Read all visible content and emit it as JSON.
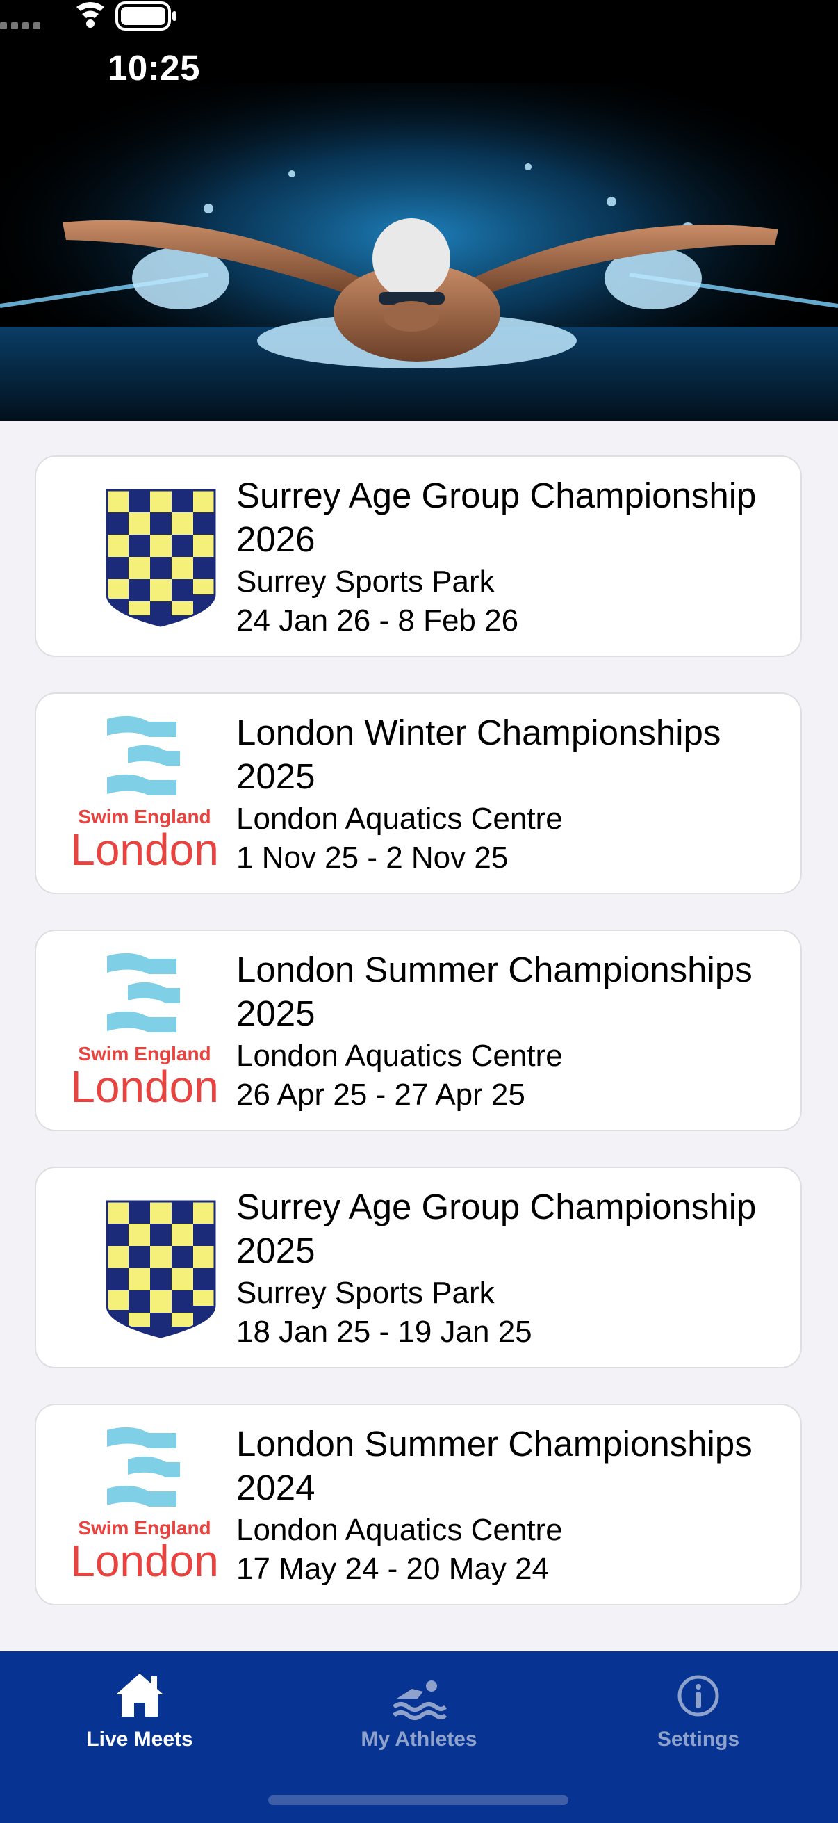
{
  "status_bar": {
    "time": "10:25"
  },
  "hero": {
    "icon": "swimmer-butterfly-photo"
  },
  "meets": [
    {
      "title": "Surrey Age Group Championship 2026",
      "venue": "Surrey Sports Park",
      "dates": "24 Jan 26 - 8 Feb 26",
      "logo": "surrey-shield"
    },
    {
      "title": "London Winter Championships 2025",
      "venue": "London Aquatics Centre",
      "dates": "1 Nov 25 - 2 Nov 25",
      "logo": "swim-england-london"
    },
    {
      "title": "London Summer Championships 2025",
      "venue": "London Aquatics Centre",
      "dates": "26 Apr 25 - 27 Apr 25",
      "logo": "swim-england-london"
    },
    {
      "title": "Surrey Age Group Championship 2025",
      "venue": "Surrey Sports Park",
      "dates": "18 Jan 25 - 19 Jan 25",
      "logo": "surrey-shield"
    },
    {
      "title": "London Summer Championships 2024",
      "venue": "London Aquatics Centre",
      "dates": "17 May 24 - 20 May 24",
      "logo": "swim-england-london"
    }
  ],
  "logos": {
    "swim_england_line1": "Swim England",
    "swim_england_line2": "London"
  },
  "tab_bar": {
    "tabs": [
      {
        "label": "Live Meets",
        "icon": "house-icon",
        "active": true
      },
      {
        "label": "My Athletes",
        "icon": "swimmer-icon",
        "active": false
      },
      {
        "label": "Settings",
        "icon": "info-circle-icon",
        "active": false
      }
    ]
  },
  "colors": {
    "tab_bar_bg": "#073392",
    "surrey_blue": "#1c2a7a",
    "surrey_yellow": "#f5f07a",
    "swim_england_cyan": "#7fcfe6",
    "swim_england_red": "#e8433f"
  }
}
